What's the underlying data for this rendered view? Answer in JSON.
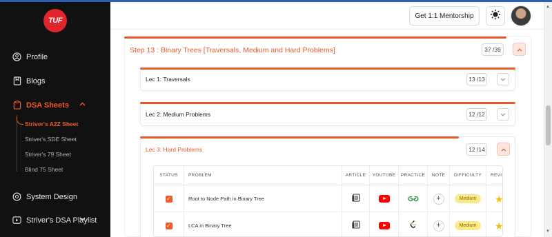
{
  "sidebar": {
    "logo_text": "TUF",
    "items": {
      "profile": "Profile",
      "blogs": "Blogs",
      "dsa_sheets": "DSA Sheets",
      "system_design": "System Design",
      "dsa_playlist": "Striver's DSA Playlist"
    },
    "sheets": [
      "Striver's A2Z Sheet",
      "Striver's SDE Sheet",
      "Striver's 79 Sheet",
      "Blind 75 Sheet"
    ]
  },
  "header": {
    "mentorship_button": "Get 1:1 Mentorship"
  },
  "step": {
    "title": "Step 13 : Binary Trees [Traversals, Medium and Hard Problems]",
    "count": "37 /39"
  },
  "lectures": [
    {
      "title": "Lec 1: Traversals",
      "count": "13 /13"
    },
    {
      "title": "Lec 2: Medium Problems",
      "count": "12 /12"
    },
    {
      "title": "Lec 3: Hard Problems",
      "count": "12 /14"
    }
  ],
  "table": {
    "headers": [
      "STATUS",
      "PROBLEM",
      "ARTICLE",
      "YOUTUBE",
      "PRACTICE",
      "NOTE",
      "DIFFICULTY",
      "REVIS"
    ],
    "rows": [
      {
        "problem": "Root to Node Path in Binary Tree",
        "difficulty": "Medium",
        "practice": "gfg"
      },
      {
        "problem": "LCA in Binary Tree",
        "difficulty": "Medium",
        "practice": "leetcode"
      }
    ]
  },
  "colors": {
    "accent": "#e55a2b",
    "sidebar_bg": "#111111",
    "medium_badge": "#fbe98a",
    "star": "#f2c200"
  }
}
